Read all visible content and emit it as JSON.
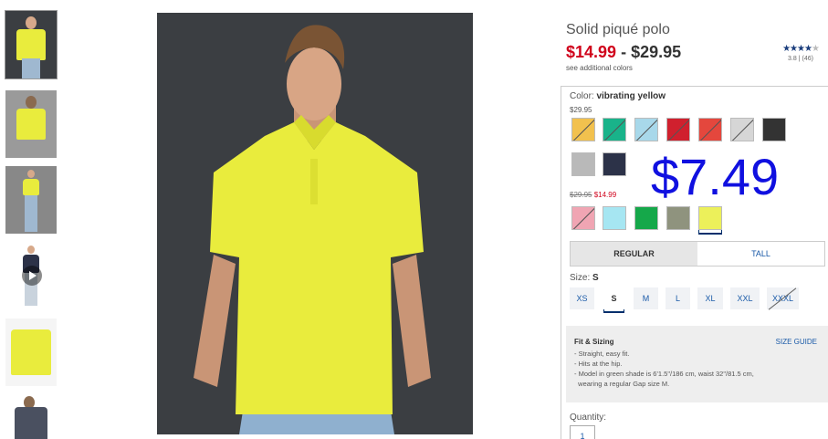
{
  "product": {
    "title": "Solid piqué polo",
    "price_sale": "$14.99",
    "price_separator": " - ",
    "price_regular": "$29.95",
    "see_colors": "see additional colors",
    "rating_value": "3.8",
    "rating_divider": "|",
    "review_count": "(46)",
    "stars_filled": "★★★★",
    "stars_empty": "★"
  },
  "color": {
    "label": "Color: ",
    "selected": "vibrating yellow",
    "group1_price": "$29.95",
    "group2_old_price": "$29.95",
    "group2_sale_price": "$14.99",
    "group1_swatches": [
      {
        "name": "gold",
        "hex": "#f2c14e",
        "out": true
      },
      {
        "name": "green",
        "hex": "#19b38a",
        "out": true
      },
      {
        "name": "light-blue",
        "hex": "#a8d8ea",
        "out": true
      },
      {
        "name": "red",
        "hex": "#d0202e",
        "out": true
      },
      {
        "name": "coral-red",
        "hex": "#e4473d",
        "out": true
      },
      {
        "name": "light-gray",
        "hex": "#d6d6d6",
        "out": true
      },
      {
        "name": "charcoal",
        "hex": "#333333",
        "out": false
      },
      {
        "name": "heather-gray",
        "hex": "#b9b9b9",
        "out": false
      },
      {
        "name": "navy",
        "hex": "#2c3248",
        "out": false
      }
    ],
    "group2_swatches": [
      {
        "name": "pink",
        "hex": "#f0a5b3",
        "out": true
      },
      {
        "name": "aqua",
        "hex": "#a6e6f2",
        "out": false
      },
      {
        "name": "kelly-green",
        "hex": "#15a84a",
        "out": false
      },
      {
        "name": "olive-gray",
        "hex": "#8f937e",
        "out": false
      },
      {
        "name": "vibrating-yellow",
        "hex": "#ecf05a",
        "out": false
      }
    ]
  },
  "overlay_price": "$7.49",
  "fit_tabs": [
    "REGULAR",
    "TALL"
  ],
  "size": {
    "label": "Size: ",
    "selected": "S",
    "options": [
      "XS",
      "S",
      "M",
      "L",
      "XL",
      "XXL",
      "XXXL"
    ]
  },
  "fit": {
    "title": "Fit & Sizing",
    "size_guide": "SIZE GUIDE",
    "bullets": [
      "- Straight, easy fit.",
      "- Hits at the hip.",
      "- Model in green shade is 6'1.5\"/186 cm, waist 32\"/81.5 cm,",
      "  wearing a regular Gap size M."
    ]
  },
  "quantity": {
    "label": "Quantity:",
    "value": "1"
  },
  "colors": {
    "accent_navy": "#002f6c",
    "link_blue": "#1a5aa8",
    "sale_red": "#d0021b",
    "shirt_yellow": "#e9ec3d",
    "overlay_blue": "#1010e0"
  }
}
